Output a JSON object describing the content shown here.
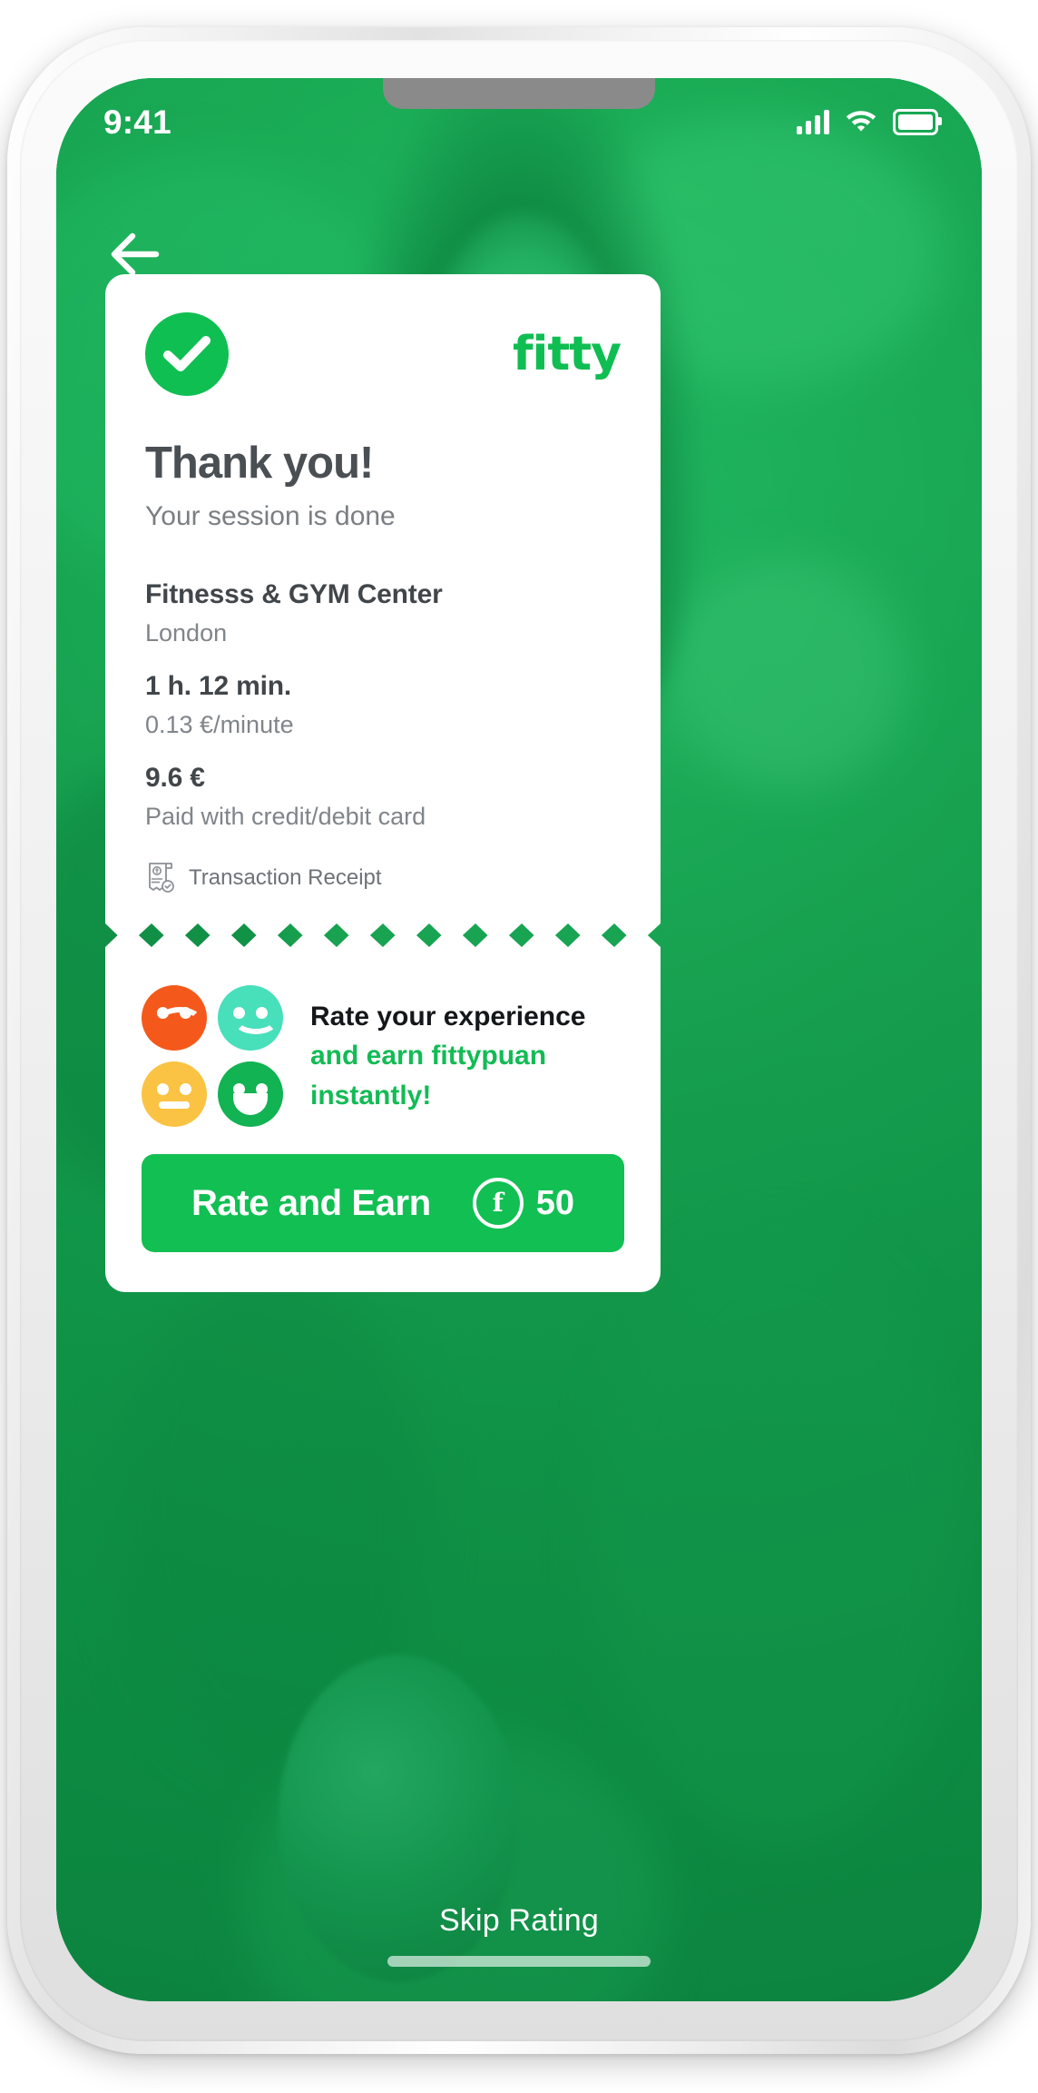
{
  "status_bar": {
    "time": "9:41",
    "icons": [
      "signal-bars-icon",
      "wifi-icon",
      "battery-icon"
    ]
  },
  "nav": {
    "back_icon": "back-arrow-icon"
  },
  "receipt": {
    "success_icon": "check-circle-icon",
    "brand": "fitty",
    "title": "Thank you!",
    "subtitle": "Your session is done",
    "venue_name": "Fitnesss & GYM Center",
    "venue_city": "London",
    "duration": "1 h. 12 min.",
    "rate": "0.13 €/minute",
    "total": "9.6 €",
    "payment_method": "Paid with credit/debit card",
    "receipt_link_label": "Transaction Receipt",
    "receipt_link_icon": "receipt-icon"
  },
  "rating": {
    "faces": [
      {
        "name": "sad-face",
        "color": "#F4591B",
        "mouth": "sad"
      },
      {
        "name": "neutral-happy-face",
        "color": "#48DFBB",
        "mouth": "smile"
      },
      {
        "name": "neutral-face",
        "color": "#FBC githubC43",
        "mouth": "flat"
      },
      {
        "name": "very-happy-face",
        "color": "#12B352",
        "mouth": "open"
      }
    ],
    "headline": "Rate your experience",
    "highlight_line_1": "and earn fittypuan",
    "highlight_line_2": "instantly!",
    "cta_label": "Rate and Earn",
    "cta_points": "50",
    "cta_coin_icon": "fittypuan-coin-icon",
    "cta_coin_letter": "f",
    "skip_label": "Skip Rating"
  },
  "colors": {
    "brand_green": "#0FBE52",
    "cta_green": "#12BF53",
    "background_green": "#12A04A",
    "text_dark": "#41464B",
    "text_muted": "#80858A"
  }
}
